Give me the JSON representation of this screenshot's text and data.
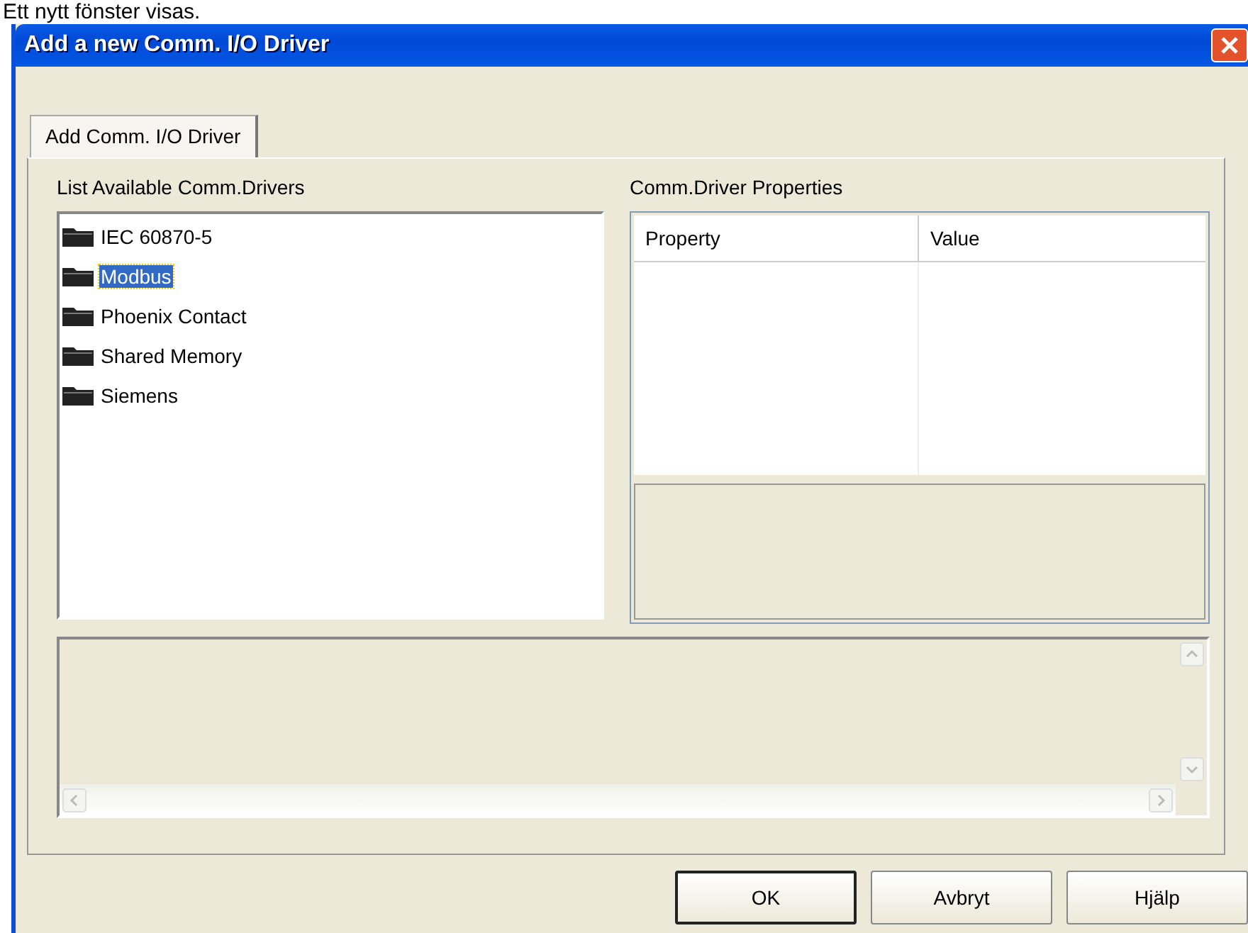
{
  "caption": "Ett nytt fönster visas.",
  "window": {
    "title": "Add a new Comm. I/O Driver"
  },
  "tabs": [
    {
      "label": "Add Comm. I/O Driver",
      "selected": true
    }
  ],
  "drivers": {
    "label": "List Available Comm.Drivers",
    "items": [
      {
        "name": "IEC 60870-5",
        "selected": false
      },
      {
        "name": "Modbus",
        "selected": true
      },
      {
        "name": "Phoenix Contact",
        "selected": false
      },
      {
        "name": "Shared Memory",
        "selected": false
      },
      {
        "name": "Siemens",
        "selected": false
      }
    ]
  },
  "properties": {
    "label": "Comm.Driver Properties",
    "columns": [
      "Property",
      "Value"
    ]
  },
  "buttons": [
    {
      "label": "OK",
      "default": true
    },
    {
      "label": "Avbryt",
      "default": false
    },
    {
      "label": "Hjälp",
      "default": false
    }
  ]
}
